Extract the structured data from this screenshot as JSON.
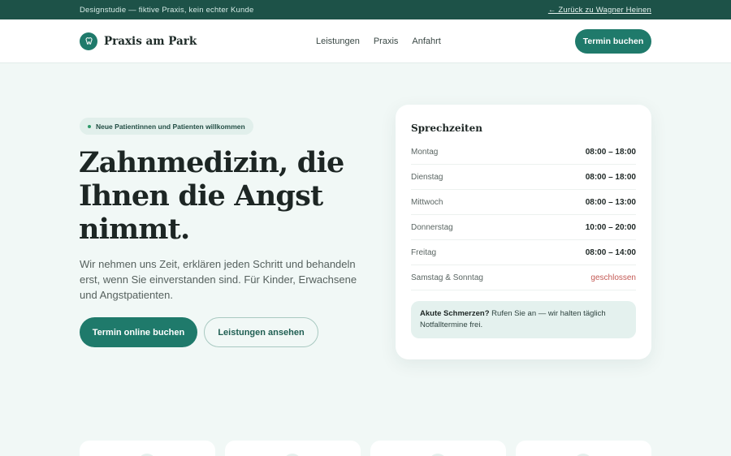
{
  "topbar": {
    "notice": "Designstudie — fiktive Praxis, kein echter Kunde",
    "back_link": "← Zurück zu Wagner Heinen"
  },
  "header": {
    "brand": "Praxis am Park",
    "logo_icon": "tooth-icon",
    "nav": [
      "Leistungen",
      "Praxis",
      "Anfahrt"
    ],
    "cta": "Termin buchen"
  },
  "hero": {
    "badge": "Neue Patientinnen und Patienten willkommen",
    "title_lines": [
      "Zahnmedizin, die",
      "Ihnen die Angst",
      "nimmt."
    ],
    "text": "Wir nehmen uns Zeit, erklären jeden Schritt und behandeln erst, wenn Sie einverstanden sind. Für Kinder, Erwachsene und Angstpatienten.",
    "primary_button": "Termin online buchen",
    "secondary_button": "Leistungen ansehen"
  },
  "hours": {
    "title": "Sprechzeiten",
    "rows": [
      {
        "day": "Montag",
        "time": "08:00 – 18:00"
      },
      {
        "day": "Dienstag",
        "time": "08:00 – 18:00"
      },
      {
        "day": "Mittwoch",
        "time": "08:00 – 13:00"
      },
      {
        "day": "Donnerstag",
        "time": "10:00 – 20:00"
      },
      {
        "day": "Freitag",
        "time": "08:00 – 14:00"
      },
      {
        "day": "Samstag & Sonntag",
        "time": "geschlossen"
      }
    ],
    "notice_bold": "Akute Schmerzen?",
    "notice_text": " Rufen Sie an — wir halten täglich Notfalltermine frei."
  },
  "colors": {
    "brand": "#1f7a6b",
    "topbar": "#1d5248",
    "background": "#f1f8f6",
    "closed": "#c45a55"
  }
}
